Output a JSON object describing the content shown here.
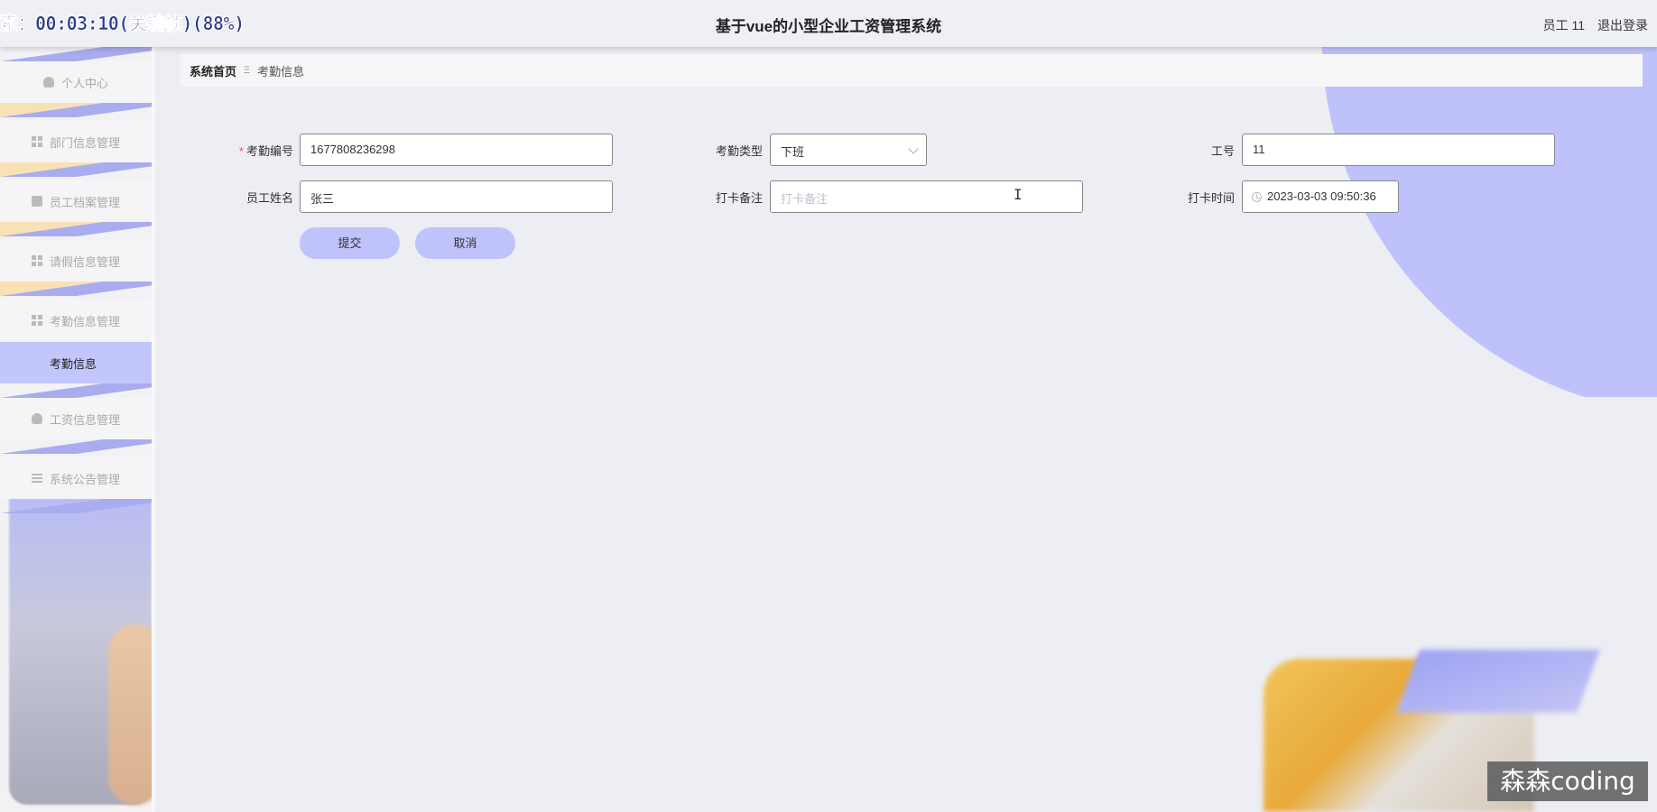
{
  "overlay": {
    "recording_text": "索：00:03:10(关键帧)(88%)"
  },
  "header": {
    "title": "基于vue的小型企业工资管理系统",
    "user_label": "员工 11",
    "logout_label": "退出登录"
  },
  "sidebar": {
    "items": [
      {
        "label": "个人中心",
        "icon": "person-icon"
      },
      {
        "label": "部门信息管理",
        "icon": "grid-icon"
      },
      {
        "label": "员工档案管理",
        "icon": "clipboard-icon"
      },
      {
        "label": "请假信息管理",
        "icon": "grid-icon"
      },
      {
        "label": "考勤信息管理",
        "icon": "grid-icon"
      },
      {
        "label": "工资信息管理",
        "icon": "person-icon"
      },
      {
        "label": "系统公告管理",
        "icon": "list-icon"
      }
    ],
    "active_sub": "考勤信息"
  },
  "breadcrumb": {
    "home": "系统首页",
    "separator": "Ξ",
    "current": "考勤信息"
  },
  "form": {
    "attendance_no": {
      "label": "考勤编号",
      "value": "1677808236298",
      "required": true
    },
    "attendance_type": {
      "label": "考勤类型",
      "value": "下班"
    },
    "employee_no": {
      "label": "工号",
      "value": "11"
    },
    "employee_name": {
      "label": "员工姓名",
      "value": "张三"
    },
    "punch_note": {
      "label": "打卡备注",
      "placeholder": "打卡备注"
    },
    "punch_time": {
      "label": "打卡时间",
      "value": "2023-03-03 09:50:36"
    },
    "submit_label": "提交",
    "cancel_label": "取消"
  },
  "watermark": "森森coding",
  "colors": {
    "accent": "#c0c2fb",
    "background": "#eceef4",
    "required": "#e55555"
  }
}
